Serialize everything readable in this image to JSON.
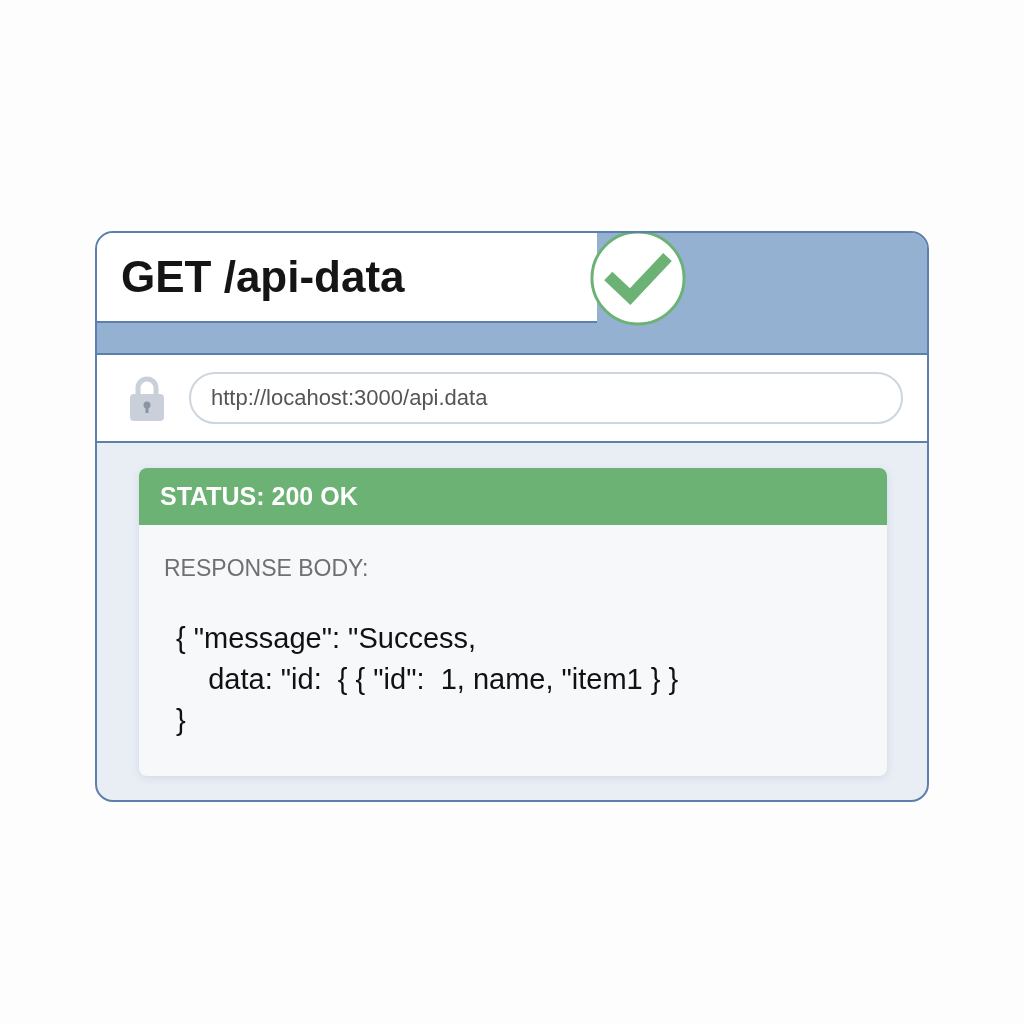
{
  "request": {
    "title": "GET /api-data",
    "url": "http://locahost:3000/api.data"
  },
  "response": {
    "status": "STATUS: 200 OK",
    "body_label": "RESPONSE BODY:",
    "body_lines": [
      "{ \"message\": \"Success,",
      "    data: \"id:  { { \"id\":  1, name, \"item1 } }",
      "}"
    ]
  }
}
